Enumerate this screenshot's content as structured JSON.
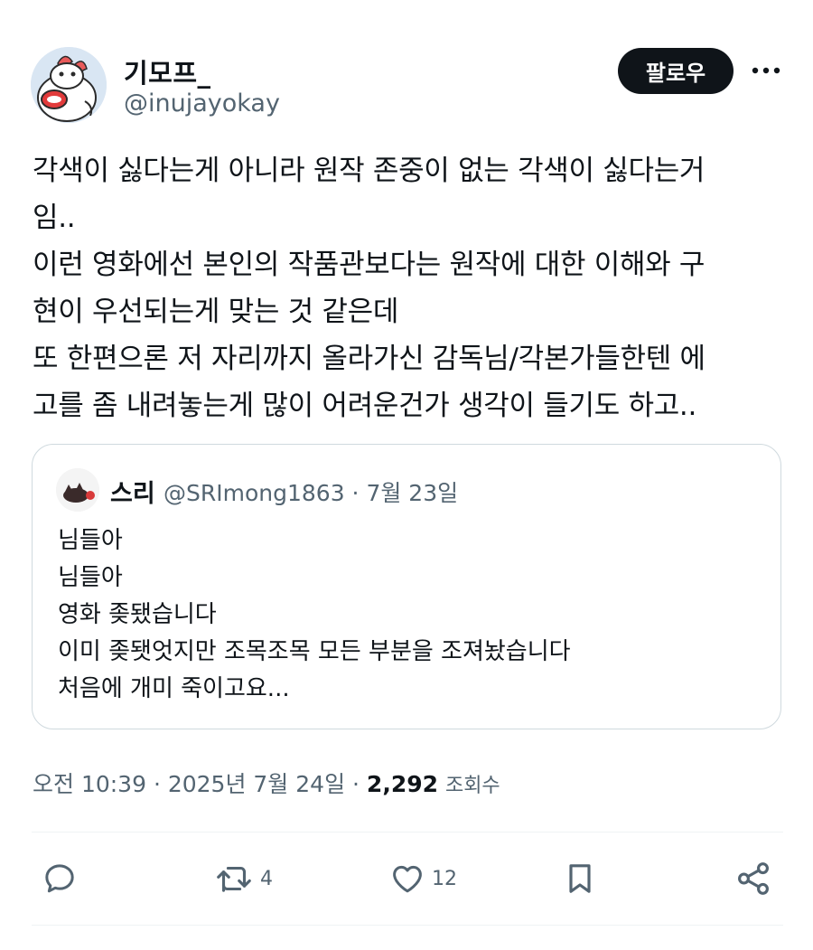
{
  "author": {
    "display_name": "기모프_",
    "handle": "@inujayokay",
    "avatar_icon": "cartoon-avatar-icon"
  },
  "follow_label": "팔로우",
  "more_icon": "more-horizontal-icon",
  "tweet_lines": [
    "각색이 싫다는게 아니라 원작 존중이 없는 각색이 싫다는거",
    "임..",
    "이런 영화에선 본인의 작품관보다는 원작에 대한 이해와 구",
    "현이 우선되는게 맞는 것 같은데",
    "또 한편으론 저 자리까지 올라가신 감독님/각본가들한텐 에",
    "고를 좀 내려놓는게 많이 어려운건가 생각이 들기도 하고.."
  ],
  "quote": {
    "name": "스리",
    "handle_date": "@SRImong1863 · 7월 23일",
    "avatar_icon": "quoted-avatar-icon",
    "lines": [
      "님들아",
      "님들아",
      "영화 좆됐습니다",
      "이미 좆됏엇지만 조목조목 모든 부분을 조져놨습니다",
      "처음에 개미 죽이고요..."
    ]
  },
  "meta": {
    "timestamp": "오전 10:39 · 2025년 7월 24일 · ",
    "views_count": "2,292",
    "views_label": "조회수"
  },
  "actions": {
    "reply_icon": "reply-icon",
    "retweet_icon": "retweet-icon",
    "retweet_count": "4",
    "like_icon": "heart-icon",
    "like_count": "12",
    "bookmark_icon": "bookmark-icon",
    "share_icon": "share-icon"
  },
  "colors": {
    "text": "#0f1419",
    "secondary": "#536471",
    "border": "#cfd9de",
    "follow_bg": "#0f1419"
  }
}
